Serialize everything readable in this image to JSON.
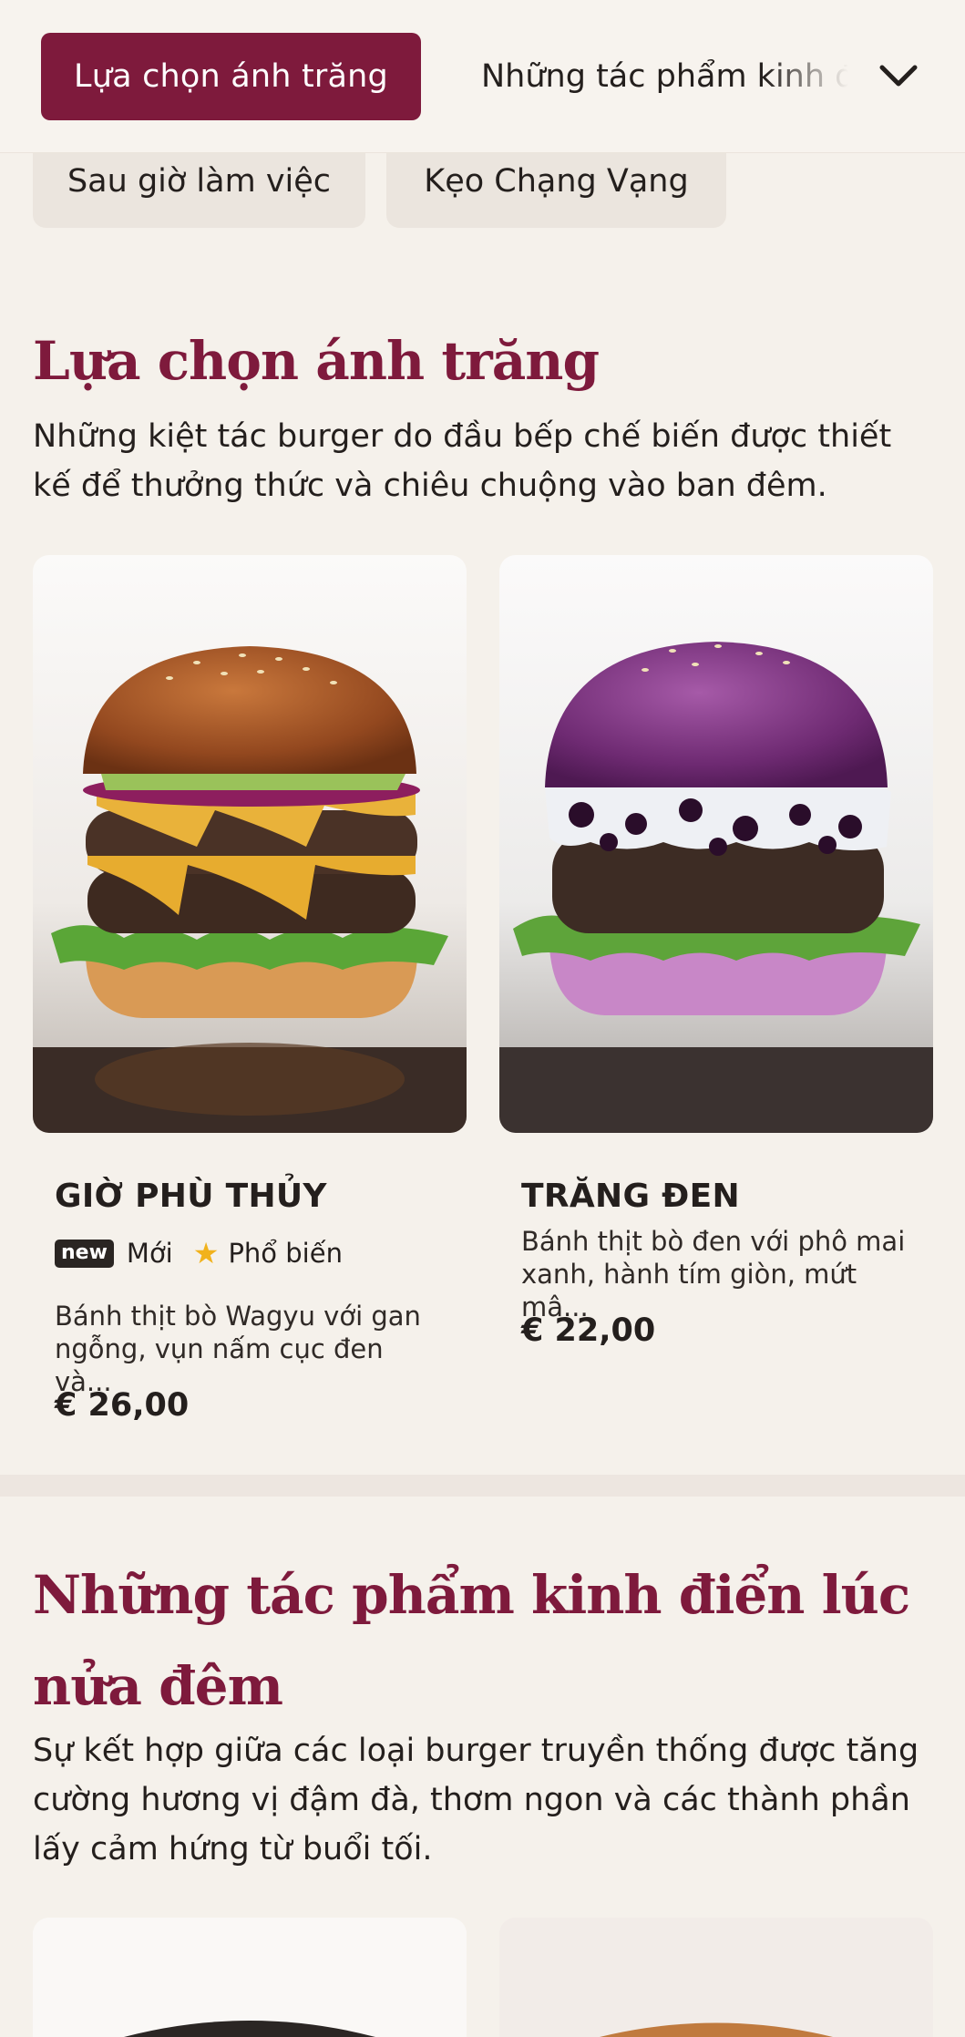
{
  "tabs": {
    "active_label": "Lựa chọn ánh trăng",
    "next_label": "Những tác phẩm kinh điển lúc nửa đêm"
  },
  "chips": [
    "Sau giờ làm việc",
    "Kẹo Chạng Vạng"
  ],
  "sections": [
    {
      "title": "Lựa chọn ánh trăng",
      "description": "Những kiệt tác burger do đầu bếp chế biến được thiết kế để thưởng thức và chiêu chuộng vào ban đêm.",
      "items": [
        {
          "name": "GIỜ PHÙ THỦY",
          "badge_new": "new",
          "tag_new": "Mới",
          "tag_popular": "Phổ biến",
          "description": "Bánh thịt bò Wagyu với gan ngỗng, vụn nấm cục đen và...",
          "price": "€ 26,00"
        },
        {
          "name": "TRĂNG ĐEN",
          "description": "Bánh thịt bò đen với phô mai xanh, hành tím giòn, mứt mâ...",
          "price": "€ 22,00"
        }
      ]
    },
    {
      "title": "Những tác phẩm kinh điển lúc nửa đêm",
      "description": "Sự kết hợp giữa các loại burger truyền thống được tăng cường hương vị đậm đà, thơm ngon và các thành phần lấy cảm hứng từ buổi tối."
    }
  ],
  "icons": {
    "dropdown": "chevron-down-icon",
    "popular": "star-icon"
  },
  "colors": {
    "accent": "#7e1a3c",
    "background": "#f5f1eb",
    "star": "#f1b21c"
  }
}
